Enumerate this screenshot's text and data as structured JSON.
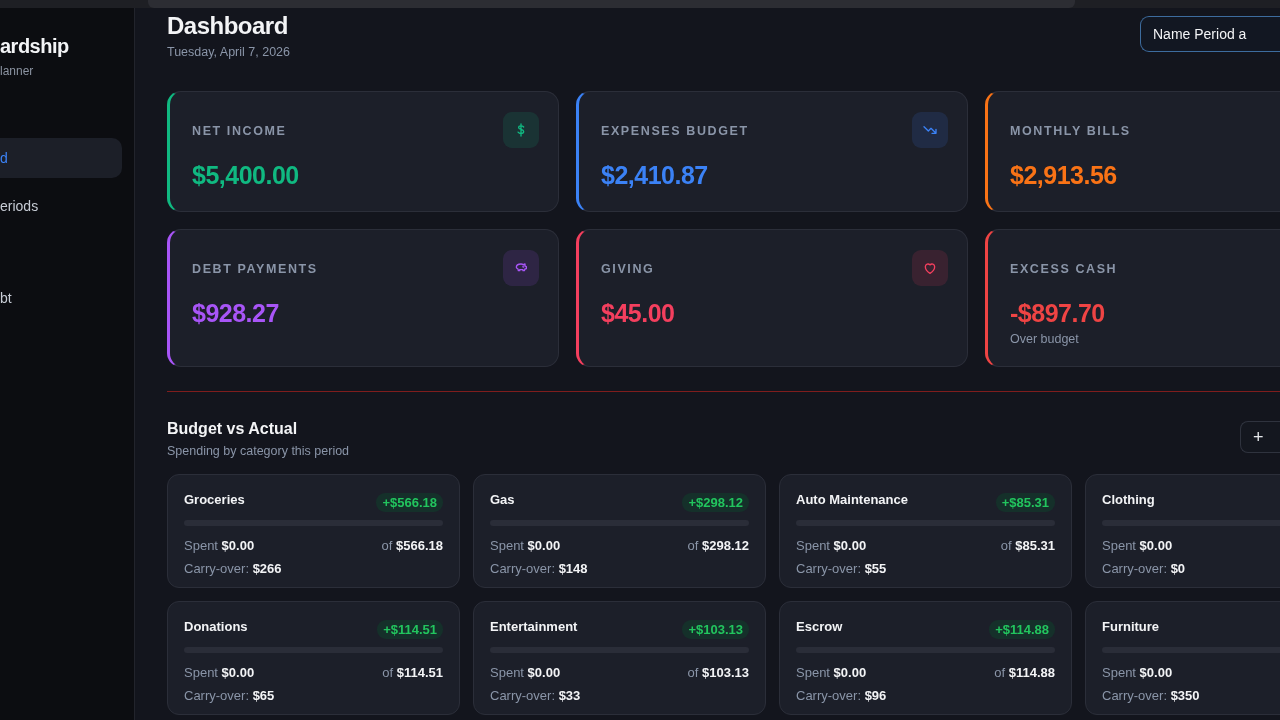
{
  "sidebar": {
    "title": "ardship",
    "subtitle": "lanner",
    "items": [
      {
        "label": "d",
        "selected": true
      },
      {
        "label": "eriods",
        "selected": false
      },
      {
        "label": "bt",
        "selected": false
      }
    ]
  },
  "header": {
    "title": "Dashboard",
    "date": "Tuesday, April 7, 2026",
    "action": "Name Period a"
  },
  "stats": [
    {
      "label": "NET INCOME",
      "value": "$5,400.00",
      "color": "#10b981",
      "kind": "dollar"
    },
    {
      "label": "EXPENSES BUDGET",
      "value": "$2,410.87",
      "color": "#3b82f6",
      "kind": "trend-down"
    },
    {
      "label": "MONTHLY BILLS",
      "value": "$2,913.56",
      "color": "#f97316"
    },
    {
      "label": "DEBT PAYMENTS",
      "value": "$928.27",
      "color": "#a855f7",
      "kind": "piggy"
    },
    {
      "label": "GIVING",
      "value": "$45.00",
      "color": "#f43f5e",
      "kind": "heart"
    },
    {
      "label": "EXCESS CASH",
      "value": "-$897.70",
      "color": "#ef4444",
      "note": "Over budget"
    }
  ],
  "budget": {
    "title": "Budget vs Actual",
    "subtitle": "Spending by category this period",
    "add_button": "+",
    "categories": [
      {
        "name": "Groceries",
        "badge": "+$566.18",
        "level": 0,
        "spent": "Spent **$0.00**",
        "of": "of **$566.18**",
        "carry": "Carry-over: **$266**"
      },
      {
        "name": "Gas",
        "badge": "+$298.12",
        "level": 0,
        "spent": "Spent **$0.00**",
        "of": "of **$298.12**",
        "carry": "Carry-over: **$148**"
      },
      {
        "name": "Auto Maintenance",
        "badge": "+$85.31",
        "level": 0,
        "spent": "Spent **$0.00**",
        "of": "of **$85.31**",
        "carry": "Carry-over: **$55**"
      },
      {
        "name": "Clothing",
        "level": 0,
        "spent": "Spent **$0.00**",
        "carry": "Carry-over: **$0**"
      },
      {
        "name": "Donations",
        "badge": "+$114.51",
        "level": 0,
        "spent": "Spent **$0.00**",
        "of": "of **$114.51**",
        "carry": "Carry-over: **$65**"
      },
      {
        "name": "Entertainment",
        "badge": "+$103.13",
        "level": 0,
        "spent": "Spent **$0.00**",
        "of": "of **$103.13**",
        "carry": "Carry-over: **$33**"
      },
      {
        "name": "Escrow",
        "badge": "+$114.88",
        "level": 0,
        "spent": "Spent **$0.00**",
        "of": "of **$114.88**",
        "carry": "Carry-over: **$96**"
      },
      {
        "name": "Furniture",
        "level": 0,
        "spent": "Spent **$0.00**",
        "carry": "Carry-over: **$350**"
      }
    ]
  }
}
